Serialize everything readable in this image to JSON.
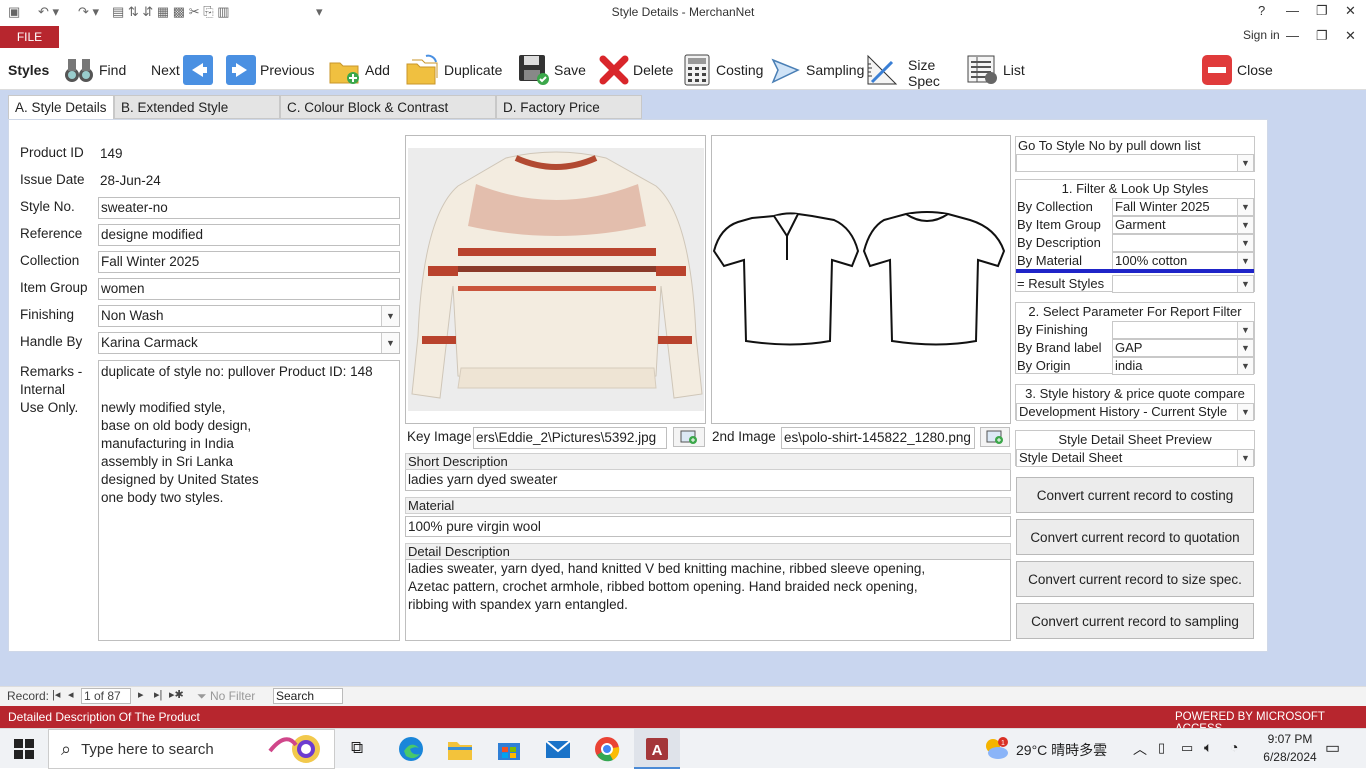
{
  "window": {
    "title": "Style Details - MerchanNet",
    "help": "?",
    "min": "—",
    "restore": "❐",
    "close": "✕"
  },
  "ribbon": {
    "file": "FILE",
    "sign_in": "Sign in"
  },
  "toolbar": {
    "styles": "Styles",
    "find": "Find",
    "next": "Next",
    "previous": "Previous",
    "add": "Add",
    "duplicate": "Duplicate",
    "save": "Save",
    "delete": "Delete",
    "costing": "Costing",
    "sampling": "Sampling",
    "size_spec_1": "Size",
    "size_spec_2": "Spec",
    "list": "List",
    "close": "Close"
  },
  "tabs": [
    "A. Style Details",
    "B. Extended Style Details",
    "C. Colour Block & Contrast Colour",
    "D. Factory Price Quote"
  ],
  "form": {
    "product_id_label": "Product ID",
    "product_id": "149",
    "issue_date_label": "Issue Date",
    "issue_date": "28-Jun-24",
    "style_no_label": "Style No.",
    "style_no": "sweater-no",
    "reference_label": "Reference",
    "reference": "designe modified",
    "collection_label": "Collection",
    "collection": "Fall Winter 2025",
    "item_group_label": "Item Group",
    "item_group": "women",
    "finishing_label": "Finishing",
    "finishing": "Non Wash",
    "handle_by_label": "Handle By",
    "handle_by": "Karina Carmack",
    "remarks_label_1": "Remarks -",
    "remarks_label_2": "Internal",
    "remarks_label_3": "Use Only.",
    "remarks_lines": [
      "duplicate of style no: pullover Product ID: 148",
      "",
      "newly modified style,",
      "base on old body design,",
      "manufacturing in India",
      "assembly in Sri Lanka",
      "designed by United States",
      "one body two styles."
    ]
  },
  "images": {
    "key_label": "Key Image",
    "key_path": "ers\\Eddie_2\\Pictures\\5392.jpg",
    "second_label": "2nd Image",
    "second_path": "es\\polo-shirt-145822_1280.png"
  },
  "desc": {
    "short_label": "Short Description",
    "short": "ladies yarn dyed sweater",
    "material_label": "Material",
    "material": "100% pure virgin wool",
    "detail_label": "Detail Description",
    "detail_lines": [
      "ladies sweater, yarn dyed, hand knitted V bed knitting machine, ribbed sleeve opening,",
      "Azetac pattern, crochet armhole, ribbed bottom opening. Hand braided neck opening,",
      "ribbing with spandex yarn entangled."
    ]
  },
  "right": {
    "goto_label": "Go To Style No by pull down list",
    "goto_value": "",
    "filter_title": "1. Filter & Look Up Styles",
    "by_collection": "By Collection",
    "by_collection_val": "Fall Winter 2025",
    "by_item_group": "By Item Group",
    "by_item_group_val": "Garment",
    "by_description": "By Description",
    "by_description_val": "",
    "by_material": "By Material",
    "by_material_val": "100% cotton",
    "result_styles": "= Result Styles",
    "result_styles_val": "",
    "param_title": "2. Select Parameter For Report Filter",
    "by_finishing": "By Finishing",
    "by_finishing_val": "",
    "by_brand": "By Brand label",
    "by_brand_val": "GAP",
    "by_origin": "By Origin",
    "by_origin_val": "india",
    "history_title": "3. Style history & price quote compare",
    "history_val": "Development History - Current Style",
    "preview_title": "Style Detail Sheet Preview",
    "preview_val": "Style Detail Sheet",
    "btn_costing": "Convert current record to costing",
    "btn_quotation": "Convert current record to quotation",
    "btn_size": "Convert current record to size spec.",
    "btn_sampling": "Convert current record to sampling"
  },
  "record": {
    "label": "Record:",
    "position": "1 of 87",
    "no_filter": "No Filter",
    "search": "Search"
  },
  "status": {
    "left": "Detailed Description Of The Product",
    "right": "POWERED BY MICROSOFT ACCESS"
  },
  "taskbar": {
    "search_placeholder": "Type here to search",
    "weather": "29°C  晴時多雲",
    "time": "9:07 PM",
    "date": "6/28/2024"
  },
  "colors": {
    "access_red": "#b7262e",
    "main_bg": "#c9d6ef",
    "blue_rule": "#1f24c8"
  }
}
